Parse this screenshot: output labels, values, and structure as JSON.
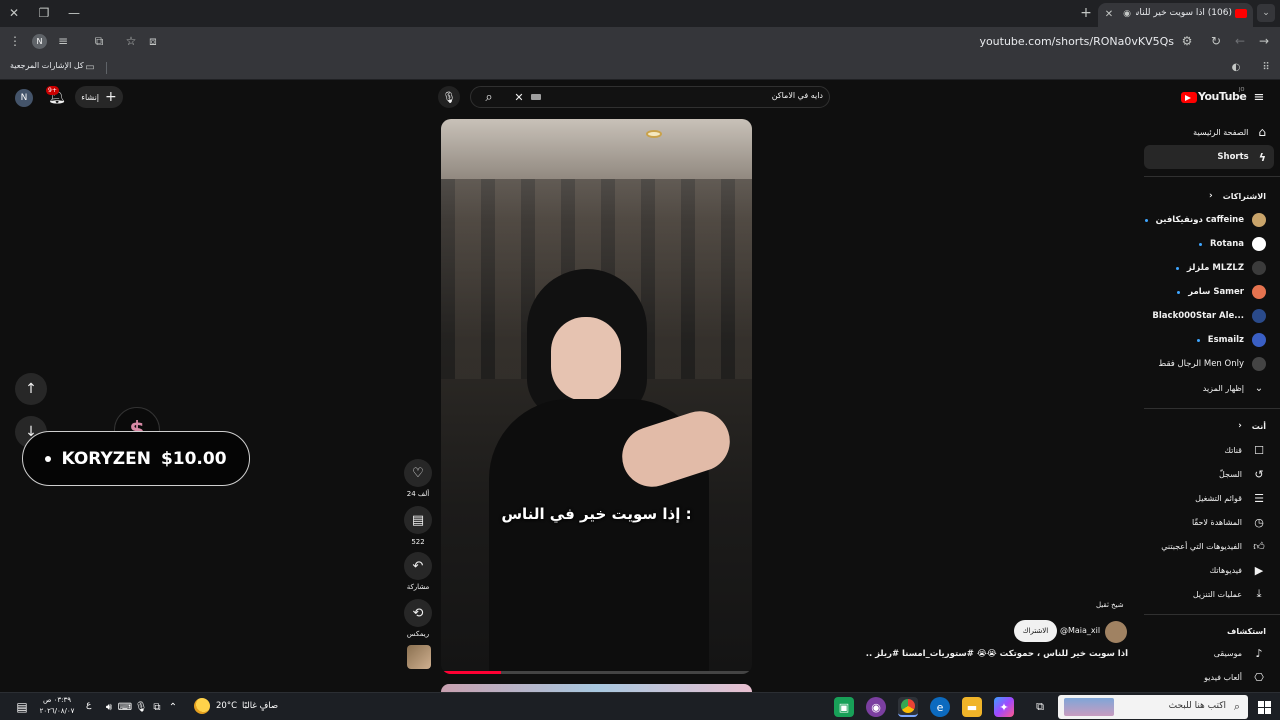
{
  "browser": {
    "tab_title": "(106) أذا سويت خير للناس ، ح...",
    "url": "youtube.com/shorts/RONa0vKV5Qs",
    "bookmarks_label": "كل الإشارات المرجعية"
  },
  "youtube": {
    "logo": "YouTube",
    "logo_sup": "JO",
    "search_value": "دايه في الاماكن",
    "create_label": "إنشاء",
    "notif_count": "9+",
    "avatar_letter": "N",
    "nav": {
      "home": "الصفحة الرئيسية",
      "shorts": "Shorts"
    },
    "subs_header": "الاشتراكات",
    "subscriptions": [
      {
        "name": "دونفيكافين caffeine",
        "color": "#c9a46a"
      },
      {
        "name": "Rotana",
        "color": "#ffffff"
      },
      {
        "name": "ملزلز MLZLZ",
        "color": "#3b3b3b"
      },
      {
        "name": "سامر Samer",
        "color": "#e5734f"
      },
      {
        "name": "Black000Star Ale...",
        "color": "#2a4a8a"
      },
      {
        "name": "Esmailz",
        "color": "#3a5fc4"
      },
      {
        "name": "الرجال فقط Men Only",
        "color": "#444444"
      }
    ],
    "show_more": "إظهار المزيد",
    "you_header": "أنت",
    "you_items": [
      {
        "label": "قناتك",
        "icon": "account-icon"
      },
      {
        "label": "السجلّ",
        "icon": "history-icon"
      },
      {
        "label": "قوائم التشغيل",
        "icon": "playlist-icon"
      },
      {
        "label": "المشاهدة لاحقًا",
        "icon": "clock-icon"
      },
      {
        "label": "الفيديوهات التي أعجبتني",
        "icon": "like-icon"
      },
      {
        "label": "فيديوهاتك",
        "icon": "video-icon"
      },
      {
        "label": "عمليات التنزيل",
        "icon": "download-icon"
      }
    ],
    "explore_header": "استكشاف",
    "explore_items": [
      {
        "label": "موسيقى",
        "icon": "music-icon"
      },
      {
        "label": "ألعاب فيديو",
        "icon": "gamepad-icon"
      }
    ],
    "short": {
      "caption": "إذا سويت خير في الناس :",
      "like_count": "24 ألف",
      "comment_count": "522",
      "share_label": "مشاركة",
      "remix_label": "ريمكس",
      "sound_label": "شيخ ثقيل",
      "channel": "@Maia_xil",
      "subscribe": "الاشتراك",
      "title": "أذا سويت خير للناس ، حموتكت 😭😭 #ستوريات_امسنا #ريلز ..."
    },
    "overlay": {
      "koryzen": "KORYZEN",
      "amount": "$10.00"
    }
  },
  "taskbar": {
    "search_placeholder": "اكتب هنا للبحث",
    "weather": "صافٍ غالبًا",
    "temp": "20°C",
    "time": "٠٣:٣٩ ص",
    "date": "٢٠٢٦/٠٨/٠٧",
    "lang": "ع"
  }
}
